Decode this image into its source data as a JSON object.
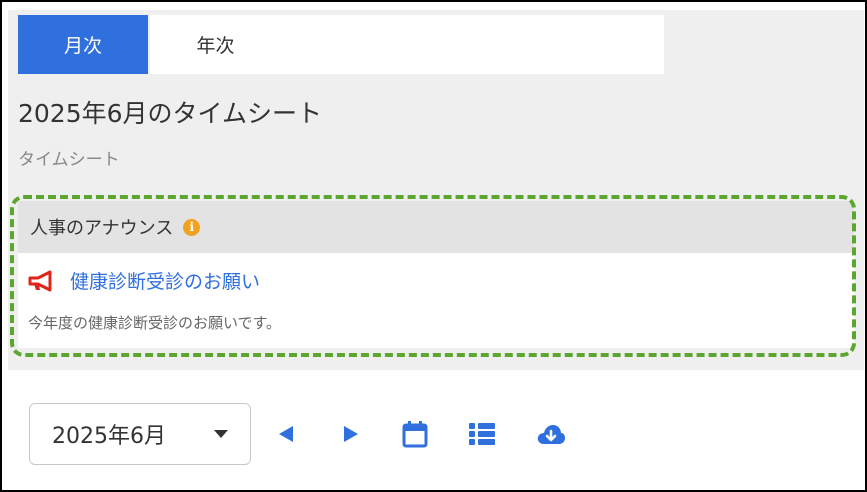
{
  "tabs": [
    {
      "label": "月次",
      "active": true
    },
    {
      "label": "年次",
      "active": false
    }
  ],
  "page": {
    "title": "2025年6月のタイムシート",
    "breadcrumb": "タイムシート"
  },
  "announcement": {
    "header": "人事のアナウンス",
    "header_icon": "info-icon",
    "item_icon": "megaphone-icon",
    "link_text": "健康診断受診のお願い",
    "body": "今年度の健康診断受診のお願いです。"
  },
  "toolbar": {
    "month_value": "2025年6月",
    "buttons": [
      "prev-month-icon",
      "next-month-icon",
      "calendar-icon",
      "list-icon",
      "cloud-download-icon"
    ]
  },
  "colors": {
    "accent": "#2f6fde",
    "highlight_dash": "#5ba630",
    "info": "#f0a11f",
    "megaphone": "#e0241c"
  }
}
